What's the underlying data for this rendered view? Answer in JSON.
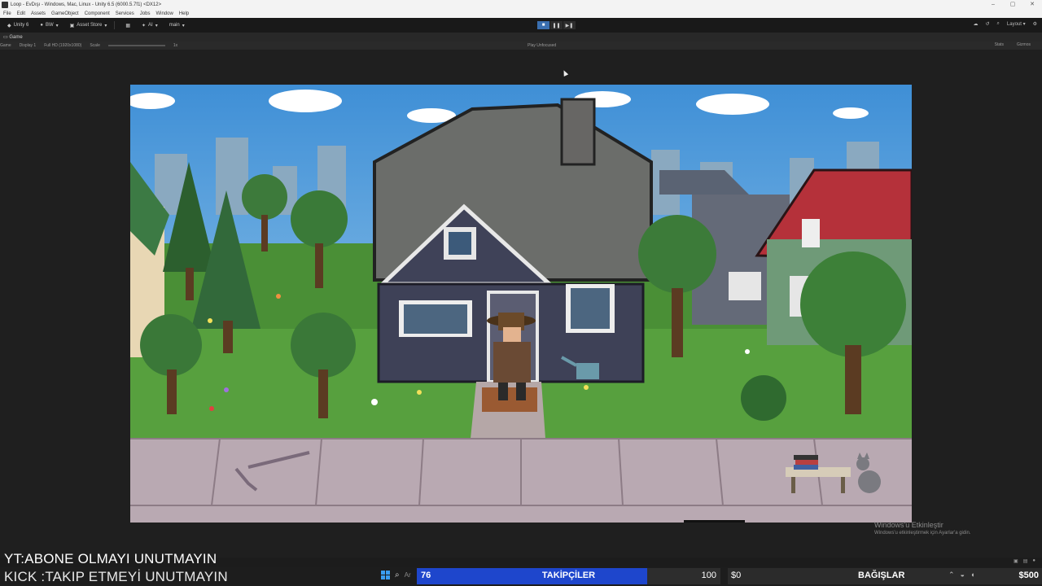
{
  "window": {
    "title": "Loop - EvDışı - Windows, Mac, Linux - Unity 6.5 (6000.5.7f1) <DX12>",
    "controls": [
      "–",
      "▢",
      "✕"
    ]
  },
  "menu": [
    "File",
    "Edit",
    "Assets",
    "GameObject",
    "Component",
    "Services",
    "Jobs",
    "Window",
    "Help"
  ],
  "toolbar": {
    "unity_label": "Unity 6",
    "account": "BW",
    "asset_store": "Asset Store",
    "ai": "AI",
    "branch": "main",
    "layout": "Layout"
  },
  "tab": {
    "label": "Game"
  },
  "game_toolbar": {
    "mode": "Game",
    "display": "Display 1",
    "resolution": "Full HD (1920x1080)",
    "scale_label": "Scale",
    "scale_value": "1x",
    "play_focused": "Play Unfocused",
    "stats": "Stats",
    "gizmos": "Gizmos"
  },
  "watermark": {
    "line1": "Windows'u Etkinleştir",
    "line2": "Windows'u etkinleştirmek için Ayarlar'a gidin."
  },
  "overlays": {
    "yt": "YT:ABONE OLMAYI UNUTMAYIN",
    "kick": "KICK :TAKIP ETMEYİ UNUTMAYIN"
  },
  "followers": {
    "current": "76",
    "label": "TAKİPÇİLER",
    "goal": "100",
    "progress": 0.76,
    "fill_color": "#1e46cc"
  },
  "donations": {
    "current": "$0",
    "label": "BAĞIŞLAR",
    "goal": "$500"
  },
  "taskbar": {
    "search_placeholder": "Ar"
  },
  "icons": [
    "unity-logo-icon",
    "windows-start-icon",
    "search-icon",
    "wifi-icon",
    "volume-icon",
    "battery-icon",
    "cat-icon",
    "books-icon",
    "rake-icon",
    "watering-can-icon"
  ]
}
